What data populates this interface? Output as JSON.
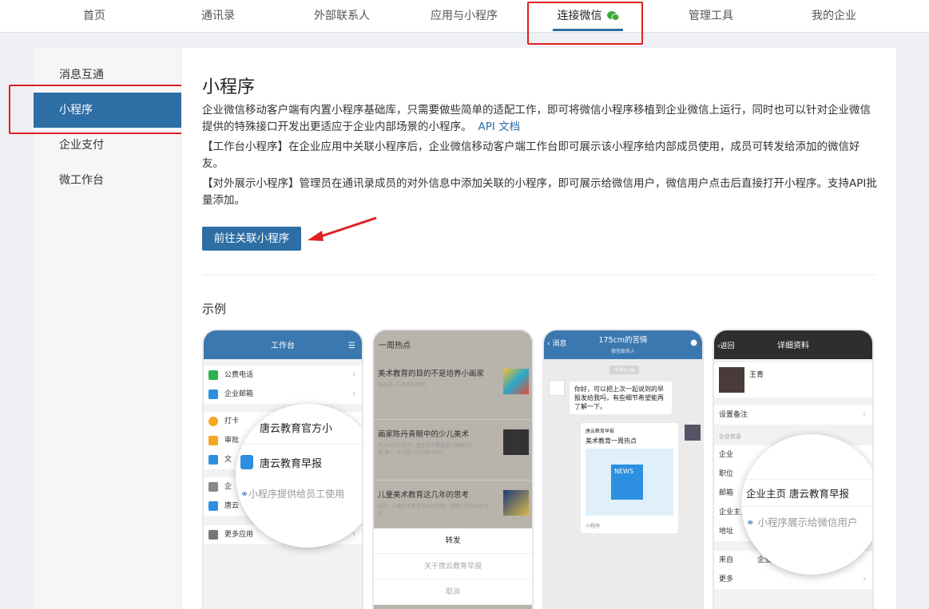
{
  "topnav": {
    "items": [
      "首页",
      "通讯录",
      "外部联系人",
      "应用与小程序",
      "连接微信",
      "管理工具",
      "我的企业"
    ],
    "active": "连接微信"
  },
  "sidebar": {
    "items": [
      "消息互通",
      "小程序",
      "企业支付",
      "微工作台"
    ],
    "active": "小程序"
  },
  "main": {
    "title": "小程序",
    "desc1": "企业微信移动客户端有内置小程序基础库，只需要做些简单的适配工作，即可将微信小程序移植到企业微信上运行，同时也可以针对企业微信提供的特殊接口开发出更适应于企业内部场景的小程序。",
    "api_link": "API 文档",
    "desc2": "【工作台小程序】在企业应用中关联小程序后，企业微信移动客户端工作台即可展示该小程序给内部成员使用，成员可转发给添加的微信好友。",
    "desc3": "【对外展示小程序】管理员在通讯录成员的对外信息中添加关联的小程序，即可展示给微信用户，微信用户点击后直接打开小程序。支持API批量添加。",
    "button": "前往关联小程序",
    "example_label": "示例"
  },
  "phone1": {
    "header": "工作台",
    "rows": [
      "公费电话",
      "企业邮箱",
      "打卡",
      "审批",
      "文",
      "企",
      "唐云",
      "更多应用"
    ],
    "magnifier": {
      "line1": "唐云教育官方小",
      "line2": "唐云教育早报",
      "line3": "小程序提供给员工使用"
    }
  },
  "phone2": {
    "header": "一周热点",
    "news": [
      {
        "title": "美术教育的目的不是培养小画家",
        "sub": "画画是一门否定的学问"
      },
      {
        "title": "画家陈丹青眼中的少儿美术",
        "sub": "只许从前的孩子，看主张不需要他们解释什么是\"美\"，什么是\"古代\"和\"现代\""
      },
      {
        "title": "儿童美术教育这几年的思考",
        "sub": "这些，儿童艺术教育的各种问题，任我们可推中些领域"
      }
    ],
    "sheet": [
      "转发",
      "关于唐云教育早报",
      "取消"
    ]
  },
  "phone3": {
    "back": "消息",
    "title": "175cm的苦情",
    "subtitle": "微信联系人",
    "time": "下午5:00",
    "bubble": "你好，可以把上次一起说到的早报发给我吗，有些细节希望能再了解一下。",
    "card_source": "唐云教育早报",
    "card_title": "美术教育一周热点",
    "card_image": "NEWS",
    "card_footer": "小程序"
  },
  "phone4": {
    "back": "返回",
    "title": "详细资料",
    "name": "王青",
    "rows": [
      "设置备注",
      "企业信息",
      "企业",
      "职位",
      "邮箱",
      "企业主页",
      "地址",
      "来自",
      "企业微信",
      "更多"
    ],
    "magnifier": {
      "line1": "企业主页  唐云教育早报",
      "line2": "小程序展示给微信用户"
    }
  },
  "colors": {
    "accent": "#2d6ea5",
    "annotation": "#e02020"
  }
}
